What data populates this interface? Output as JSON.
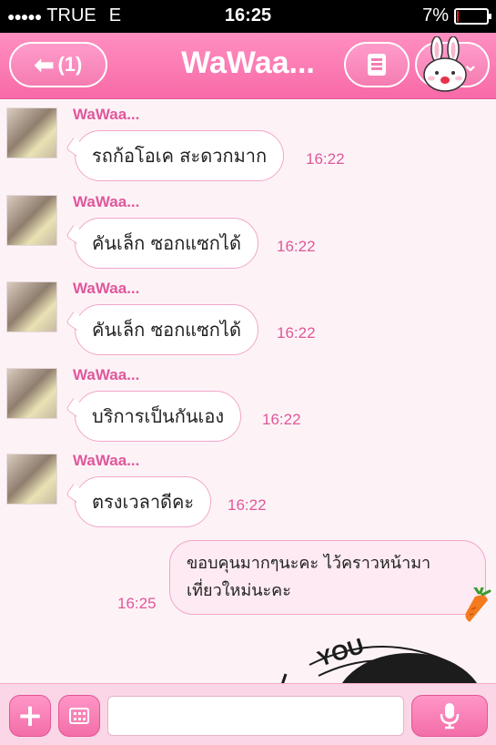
{
  "status_bar": {
    "signal_dots": "●●●●●",
    "carrier": "TRUE",
    "network": "E",
    "time": "16:25",
    "battery_percent": "7%",
    "battery_level": 0.07
  },
  "header": {
    "back_count": "(1)",
    "title": "WaWaa...",
    "accent_color": "#f86aa7"
  },
  "messages": [
    {
      "sender": "WaWaa...",
      "text": "รถก้อโอเค สะดวกมาก",
      "time": "16:22"
    },
    {
      "sender": "WaWaa...",
      "text": "คันเล็ก ซอกแซกได้",
      "time": "16:22"
    },
    {
      "sender": "WaWaa...",
      "text": "คันเล็ก ซอกแซกได้",
      "time": "16:22"
    },
    {
      "sender": "WaWaa...",
      "text": "บริการเป็นกันเอง",
      "time": "16:22"
    },
    {
      "sender": "WaWaa...",
      "text": "ตรงเวลาดีคะ",
      "time": "16:22"
    }
  ],
  "outgoing": {
    "line1": "ขอบคุนมากๆนะคะ ไว้คราวหน้ามา",
    "line2": "เที่ยวใหม่นะคะ",
    "time": "16:25"
  },
  "sticker_text": "YOU",
  "input": {
    "value": "",
    "placeholder": ""
  }
}
